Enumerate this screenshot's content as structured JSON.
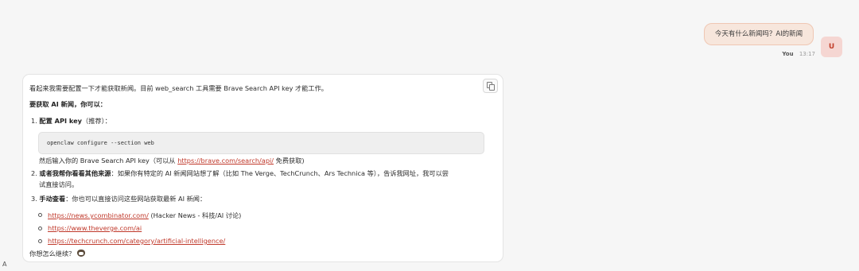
{
  "user_message": {
    "text": "今天有什么新闻吗？AI的新闻",
    "author": "You",
    "time": "13:17",
    "avatar": "U"
  },
  "assistant_message": {
    "intro": "看起来我需要配置一下才能获取新闻。目前 web_search 工具需要 Brave Search API key 才能工作。",
    "heading": "要获取 AI 新闻，你可以：",
    "step1": {
      "number": "1.",
      "bold": "配置 API key",
      "rest": "（推荐）："
    },
    "code": "openclaw configure --section web",
    "step1_after": {
      "before": "然后输入你的 Brave Search API key（可以从 ",
      "link": "https://brave.com/search/api/",
      "after": " 免费获取)"
    },
    "step2": {
      "number": "2.",
      "bold": "或者我帮你看看其他来源",
      "rest_line1": "：如果你有特定的 AI 新闻网站想了解（比如 The Verge、TechCrunch、Ars Technica 等），告诉我网址，我可以尝",
      "rest_line2": "试直接访问。"
    },
    "step3": {
      "number": "3.",
      "bold": "手动查看",
      "rest": "：你也可以直接访问这些网站获取最新 AI 新闻："
    },
    "links": [
      {
        "url": "https://news.ycombinator.com/",
        "note": " (Hacker News - 科技/AI 讨论)"
      },
      {
        "url": "https://www.theverge.com/ai",
        "note": ""
      },
      {
        "url": "https://techcrunch.com/category/artificial-intelligence/",
        "note": ""
      }
    ],
    "closing": "你想怎么继续？",
    "copy_icon": "copy-icon",
    "emoji_icon": "cat-face-emoji"
  },
  "footer_letter": "A",
  "colors": {
    "user_bubble": "#f7e6dc",
    "link": "#c0392b",
    "avatar_text": "#c2412d"
  }
}
